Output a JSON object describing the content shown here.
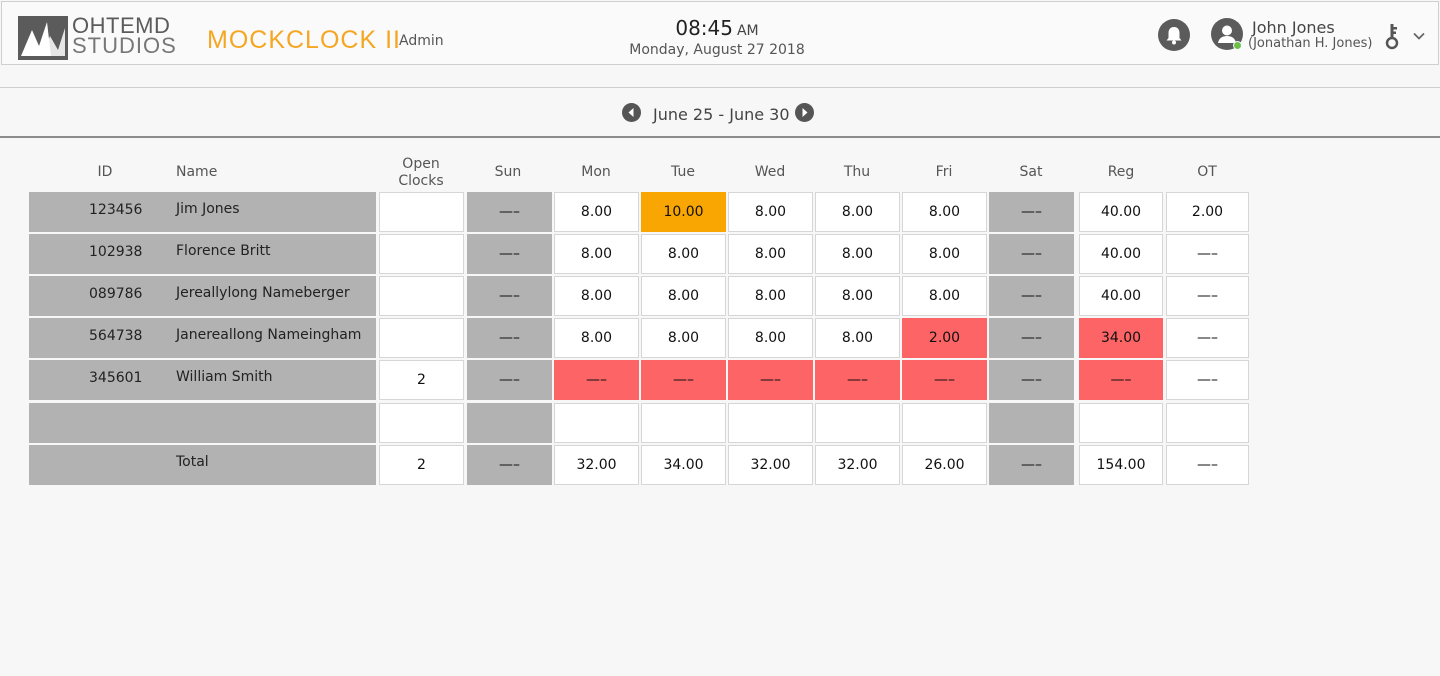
{
  "header": {
    "logo_line1": "OHTEMD",
    "logo_line2": "STUDIOS",
    "app_title": "MOCKCLOCK II",
    "role": "Admin",
    "time": "08:45",
    "ampm": "AM",
    "date": "Monday, August 27 2018",
    "user_name": "John Jones",
    "user_full": "(Jonathan H. Jones)",
    "icons": {
      "notifications": "bell-icon",
      "user": "user-avatar-icon",
      "key": "key-icon",
      "menu": "chevron-down-icon"
    }
  },
  "week": {
    "label": "June 25 - June 30",
    "prev_icon": "arrow-left-circle-icon",
    "next_icon": "arrow-right-circle-icon"
  },
  "columns": {
    "id": "ID",
    "name": "Name",
    "open_clocks_1": "Open",
    "open_clocks_2": "Clocks",
    "sun": "Sun",
    "mon": "Mon",
    "tue": "Tue",
    "wed": "Wed",
    "thu": "Thu",
    "fri": "Fri",
    "sat": "Sat",
    "reg": "Reg",
    "ot": "OT"
  },
  "colors": {
    "accent": "#f5a623",
    "warning": "#f9a602",
    "error": "#fc6465",
    "inactive": "#b2b2b2"
  },
  "rows": [
    {
      "id": "123456",
      "name": "Jim Jones",
      "open": "",
      "sun": "—–",
      "mon": "8.00",
      "tue": "10.00",
      "wed": "8.00",
      "thu": "8.00",
      "fri": "8.00",
      "sat": "—–",
      "reg": "40.00",
      "ot": "2.00",
      "tue_status": "warning"
    },
    {
      "id": "102938",
      "name": "Florence Britt",
      "open": "",
      "sun": "—–",
      "mon": "8.00",
      "tue": "8.00",
      "wed": "8.00",
      "thu": "8.00",
      "fri": "8.00",
      "sat": "—–",
      "reg": "40.00",
      "ot": "—–"
    },
    {
      "id": "089786",
      "name": "Jereallylong Nameberger",
      "open": "",
      "sun": "—–",
      "mon": "8.00",
      "tue": "8.00",
      "wed": "8.00",
      "thu": "8.00",
      "fri": "8.00",
      "sat": "—–",
      "reg": "40.00",
      "ot": "—–"
    },
    {
      "id": "564738",
      "name": "Janereallong Nameingham",
      "open": "",
      "sun": "—–",
      "mon": "8.00",
      "tue": "8.00",
      "wed": "8.00",
      "thu": "8.00",
      "fri": "2.00",
      "sat": "—–",
      "reg": "34.00",
      "ot": "—–",
      "fri_status": "error",
      "reg_status": "error"
    },
    {
      "id": "345601",
      "name": "William Smith",
      "open": "2",
      "sun": "—–",
      "mon": "—–",
      "tue": "—–",
      "wed": "—–",
      "thu": "—–",
      "fri": "—–",
      "sat": "—–",
      "reg": "—–",
      "ot": "—–",
      "mon_status": "error",
      "tue_status": "error",
      "wed_status": "error",
      "thu_status": "error",
      "fri_status": "error",
      "reg_status": "error"
    },
    {
      "id": "",
      "name": "",
      "open": "",
      "sun": "",
      "mon": "",
      "tue": "",
      "wed": "",
      "thu": "",
      "fri": "",
      "sat": "",
      "reg": "",
      "ot": ""
    }
  ],
  "total": {
    "label": "Total",
    "open": "2",
    "sun": "—–",
    "mon": "32.00",
    "tue": "34.00",
    "wed": "32.00",
    "thu": "32.00",
    "fri": "26.00",
    "sat": "—–",
    "reg": "154.00",
    "ot": "—–"
  }
}
